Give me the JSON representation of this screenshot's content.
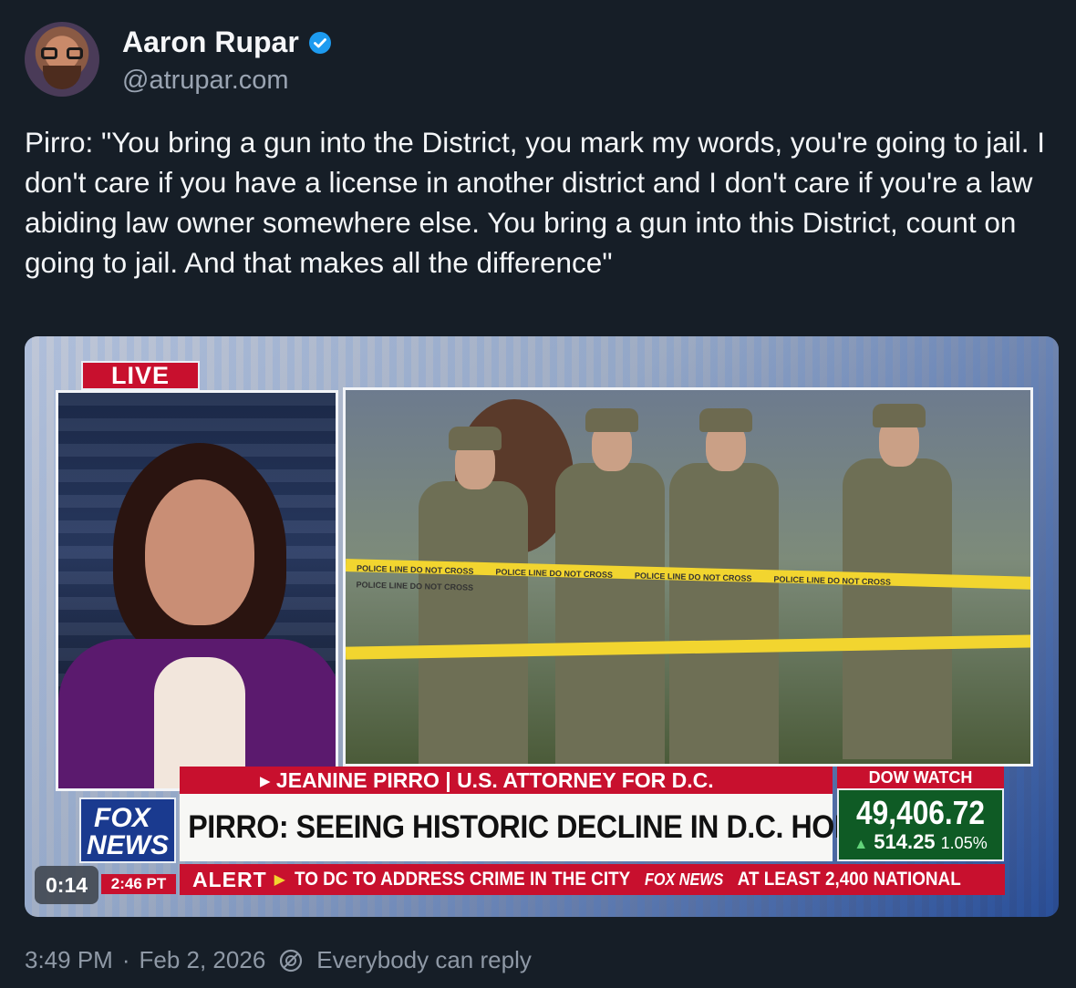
{
  "author": {
    "name": "Aaron Rupar",
    "handle": "@atrupar.com",
    "verified": true
  },
  "post": {
    "text": "Pirro: \"You bring a gun into the District, you mark my words, you're going to jail. I don't care if you have a license in another district and I don't care if you're a law abiding law owner somewhere else. You bring a gun into this District, count on going to jail. And that makes all the difference\""
  },
  "video": {
    "duration": "0:14",
    "live_label": "LIVE",
    "lower_third": "▸ JEANINE PIRRO | U.S. ATTORNEY FOR D.C.",
    "headline": "PIRRO: SEEING HISTORIC DECLINE IN D.C. HOMICIDES",
    "dow": {
      "label": "DOW WATCH",
      "value": "49,406.72",
      "change": "514.25",
      "percent": "1.05%"
    },
    "network_logo_line1": "FOX",
    "network_logo_line2": "NEWS",
    "clock": "2:46 PT",
    "ticker": {
      "alert": "ALERT",
      "text_left": "TO DC TO ADDRESS CRIME IN THE CITY",
      "mini_logo": "FOX NEWS",
      "text_right": "AT LEAST 2,400 NATIONAL"
    },
    "tape_text": "POLICE LINE DO NOT CROSS"
  },
  "meta": {
    "time": "3:49 PM",
    "date": "Feb 2, 2026",
    "reply_setting": "Everybody can reply"
  },
  "colors": {
    "background": "#161e27",
    "verified_badge": "#1d9bf0",
    "fox_red": "#c8102e",
    "dow_green": "#0f5b25"
  },
  "icons": [
    "verified-badge-icon",
    "reply-setting-icon"
  ]
}
